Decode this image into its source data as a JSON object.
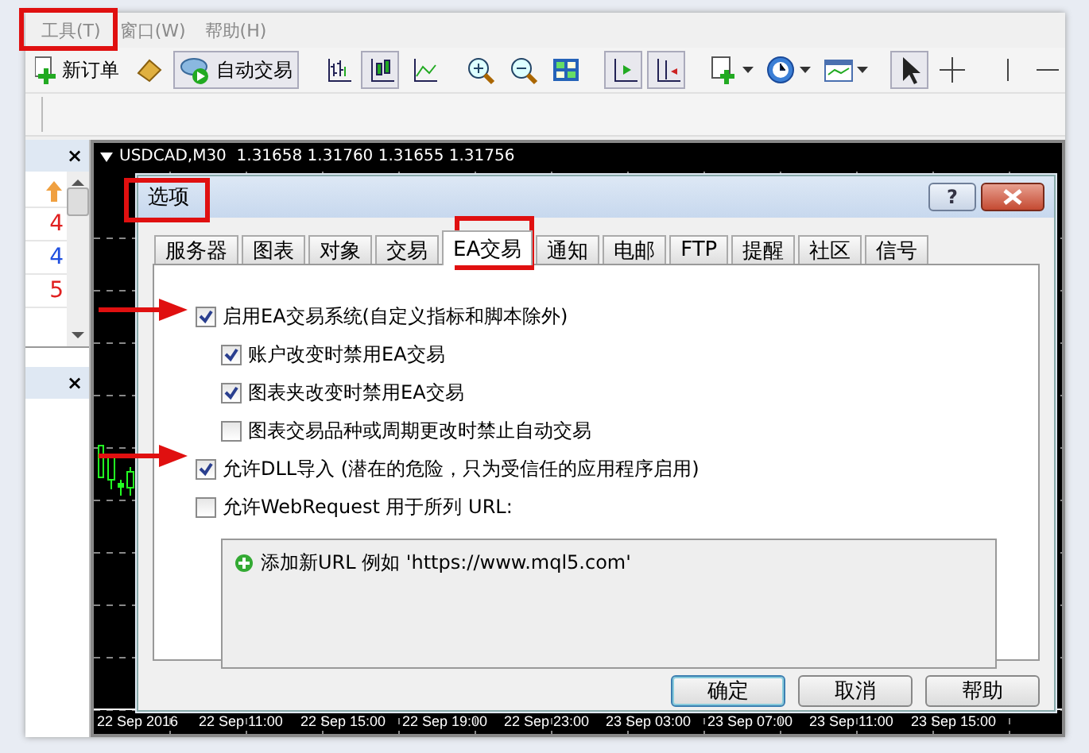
{
  "menu": [
    {
      "label": "工具(T)"
    },
    {
      "label": "窗口(W)"
    },
    {
      "label": "帮助(H)"
    }
  ],
  "toolbar": {
    "new_order": "新订单",
    "auto_trading": "自动交易"
  },
  "side_panel": {
    "close": "×",
    "items": [
      {
        "text": "4",
        "color": "#e02020"
      },
      {
        "text": "4",
        "color": "#2050e0"
      },
      {
        "text": "5",
        "color": "#e02020"
      }
    ],
    "close_2": "×"
  },
  "chart": {
    "header": "USDCAD,M30  1.31658 1.31760 1.31655 1.31756",
    "time_axis": [
      "22 Sep 2016",
      "22 Sep 11:00",
      "22 Sep 15:00",
      "22 Sep 19:00",
      "22 Sep 23:00",
      "23 Sep 03:00",
      "23 Sep 07:00",
      "23 Sep 11:00",
      "23 Sep 15:00"
    ]
  },
  "dialog": {
    "title": "选项",
    "help": "?",
    "tabs": [
      {
        "label": "服务器",
        "selected": false
      },
      {
        "label": "图表",
        "selected": false
      },
      {
        "label": "对象",
        "selected": false
      },
      {
        "label": "交易",
        "selected": false
      },
      {
        "label": "EA交易",
        "selected": true
      },
      {
        "label": "通知",
        "selected": false
      },
      {
        "label": "电邮",
        "selected": false
      },
      {
        "label": "FTP",
        "selected": false
      },
      {
        "label": "提醒",
        "selected": false
      },
      {
        "label": "社区",
        "selected": false
      },
      {
        "label": "信号",
        "selected": false
      }
    ],
    "options": [
      {
        "label": "启用EA交易系统(自定义指标和脚本除外)",
        "checked": true,
        "children": [
          {
            "label": "账户改变时禁用EA交易",
            "checked": true
          },
          {
            "label": "图表夹改变时禁用EA交易",
            "checked": true
          },
          {
            "label": "图表交易品种或周期更改时禁止自动交易",
            "checked": false
          }
        ]
      },
      {
        "label": "允许DLL导入 (潜在的危险，只为受信任的应用程序启用)",
        "checked": true
      },
      {
        "label": "允许WebRequest 用于所列 URL:",
        "checked": false
      }
    ],
    "url_list": {
      "add_entry": "添加新URL 例如 'https://www.mql5.com'"
    },
    "buttons": [
      {
        "label": "确定",
        "default": true
      },
      {
        "label": "取消",
        "default": false
      },
      {
        "label": "帮助",
        "default": false
      }
    ]
  }
}
